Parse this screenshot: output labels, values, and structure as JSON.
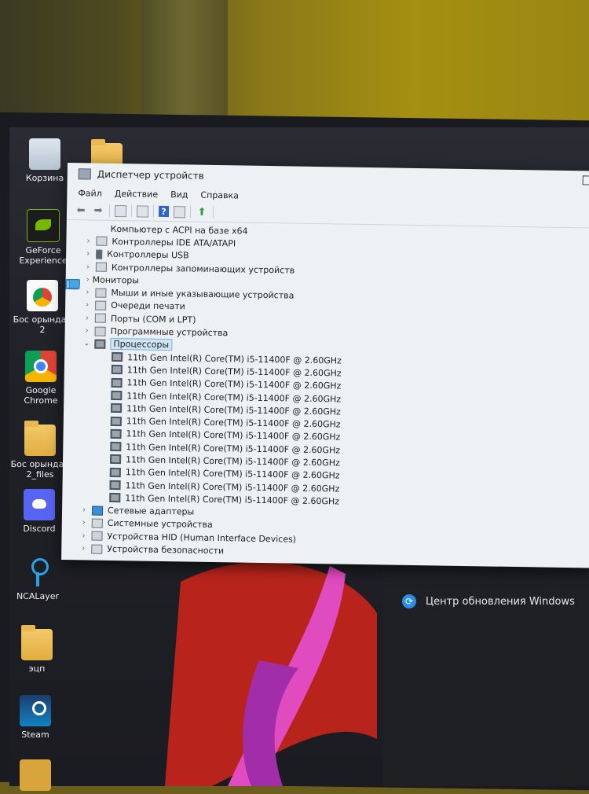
{
  "desktop": {
    "icons": [
      {
        "label": "Корзина",
        "icon": "recycle-bin-icon"
      },
      {
        "label": "GeForce Experience",
        "icon": "nvidia-icon"
      },
      {
        "label": "Бос орындар 2",
        "icon": "chrome-document-icon"
      },
      {
        "label": "Google Chrome",
        "icon": "chrome-icon"
      },
      {
        "label": "Бос орындар 2_files",
        "icon": "folder-icon"
      },
      {
        "label": "Discord",
        "icon": "discord-icon"
      },
      {
        "label": "NCALayer",
        "icon": "ncalayer-icon"
      },
      {
        "label": "эцп",
        "icon": "folder-icon"
      },
      {
        "label": "Steam",
        "icon": "steam-icon"
      }
    ]
  },
  "right_panel": {
    "update_label": "Центр обновления Windows"
  },
  "window": {
    "title": "Диспетчер устройств",
    "menu": [
      "Файл",
      "Действие",
      "Вид",
      "Справка"
    ],
    "tree": [
      {
        "label": "Компьютер с ACPI на базе x64",
        "indent": 2,
        "chev": "",
        "icon": "monitor"
      },
      {
        "label": "Контроллеры IDE ATA/ATAPI",
        "indent": 1,
        "chev": "›",
        "icon": ""
      },
      {
        "label": "Контроллеры USB",
        "indent": 1,
        "chev": "›",
        "icon": "usb"
      },
      {
        "label": "Контроллеры запоминающих устройств",
        "indent": 1,
        "chev": "›",
        "icon": ""
      },
      {
        "label": "Мониторы",
        "indent": 1,
        "chev": "›",
        "icon": "monitor"
      },
      {
        "label": "Мыши и иные указывающие устройства",
        "indent": 1,
        "chev": "›",
        "icon": "hid"
      },
      {
        "label": "Очереди печати",
        "indent": 1,
        "chev": "›",
        "icon": ""
      },
      {
        "label": "Порты (COM и LPT)",
        "indent": 1,
        "chev": "›",
        "icon": ""
      },
      {
        "label": "Программные устройства",
        "indent": 1,
        "chev": "›",
        "icon": "hid"
      },
      {
        "label": "Процессоры",
        "indent": 1,
        "chev": "⌄",
        "icon": "cpu",
        "selected": true
      },
      {
        "label": "11th Gen Intel(R) Core(TM) i5-11400F @ 2.60GHz",
        "indent": 2,
        "chev": "",
        "icon": "cpu"
      },
      {
        "label": "11th Gen Intel(R) Core(TM) i5-11400F @ 2.60GHz",
        "indent": 2,
        "chev": "",
        "icon": "cpu"
      },
      {
        "label": "11th Gen Intel(R) Core(TM) i5-11400F @ 2.60GHz",
        "indent": 2,
        "chev": "",
        "icon": "cpu"
      },
      {
        "label": "11th Gen Intel(R) Core(TM) i5-11400F @ 2.60GHz",
        "indent": 2,
        "chev": "",
        "icon": "cpu"
      },
      {
        "label": "11th Gen Intel(R) Core(TM) i5-11400F @ 2.60GHz",
        "indent": 2,
        "chev": "",
        "icon": "cpu"
      },
      {
        "label": "11th Gen Intel(R) Core(TM) i5-11400F @ 2.60GHz",
        "indent": 2,
        "chev": "",
        "icon": "cpu"
      },
      {
        "label": "11th Gen Intel(R) Core(TM) i5-11400F @ 2.60GHz",
        "indent": 2,
        "chev": "",
        "icon": "cpu"
      },
      {
        "label": "11th Gen Intel(R) Core(TM) i5-11400F @ 2.60GHz",
        "indent": 2,
        "chev": "",
        "icon": "cpu"
      },
      {
        "label": "11th Gen Intel(R) Core(TM) i5-11400F @ 2.60GHz",
        "indent": 2,
        "chev": "",
        "icon": "cpu"
      },
      {
        "label": "11th Gen Intel(R) Core(TM) i5-11400F @ 2.60GHz",
        "indent": 2,
        "chev": "",
        "icon": "cpu"
      },
      {
        "label": "11th Gen Intel(R) Core(TM) i5-11400F @ 2.60GHz",
        "indent": 2,
        "chev": "",
        "icon": "cpu"
      },
      {
        "label": "11th Gen Intel(R) Core(TM) i5-11400F @ 2.60GHz",
        "indent": 2,
        "chev": "",
        "icon": "cpu"
      },
      {
        "label": "Сетевые адаптеры",
        "indent": 1,
        "chev": "›",
        "icon": "net"
      },
      {
        "label": "Системные устройства",
        "indent": 1,
        "chev": "›",
        "icon": ""
      },
      {
        "label": "Устройства HID (Human Interface Devices)",
        "indent": 1,
        "chev": "›",
        "icon": "hid"
      },
      {
        "label": "Устройства безопасности",
        "indent": 1,
        "chev": "›",
        "icon": ""
      }
    ]
  }
}
